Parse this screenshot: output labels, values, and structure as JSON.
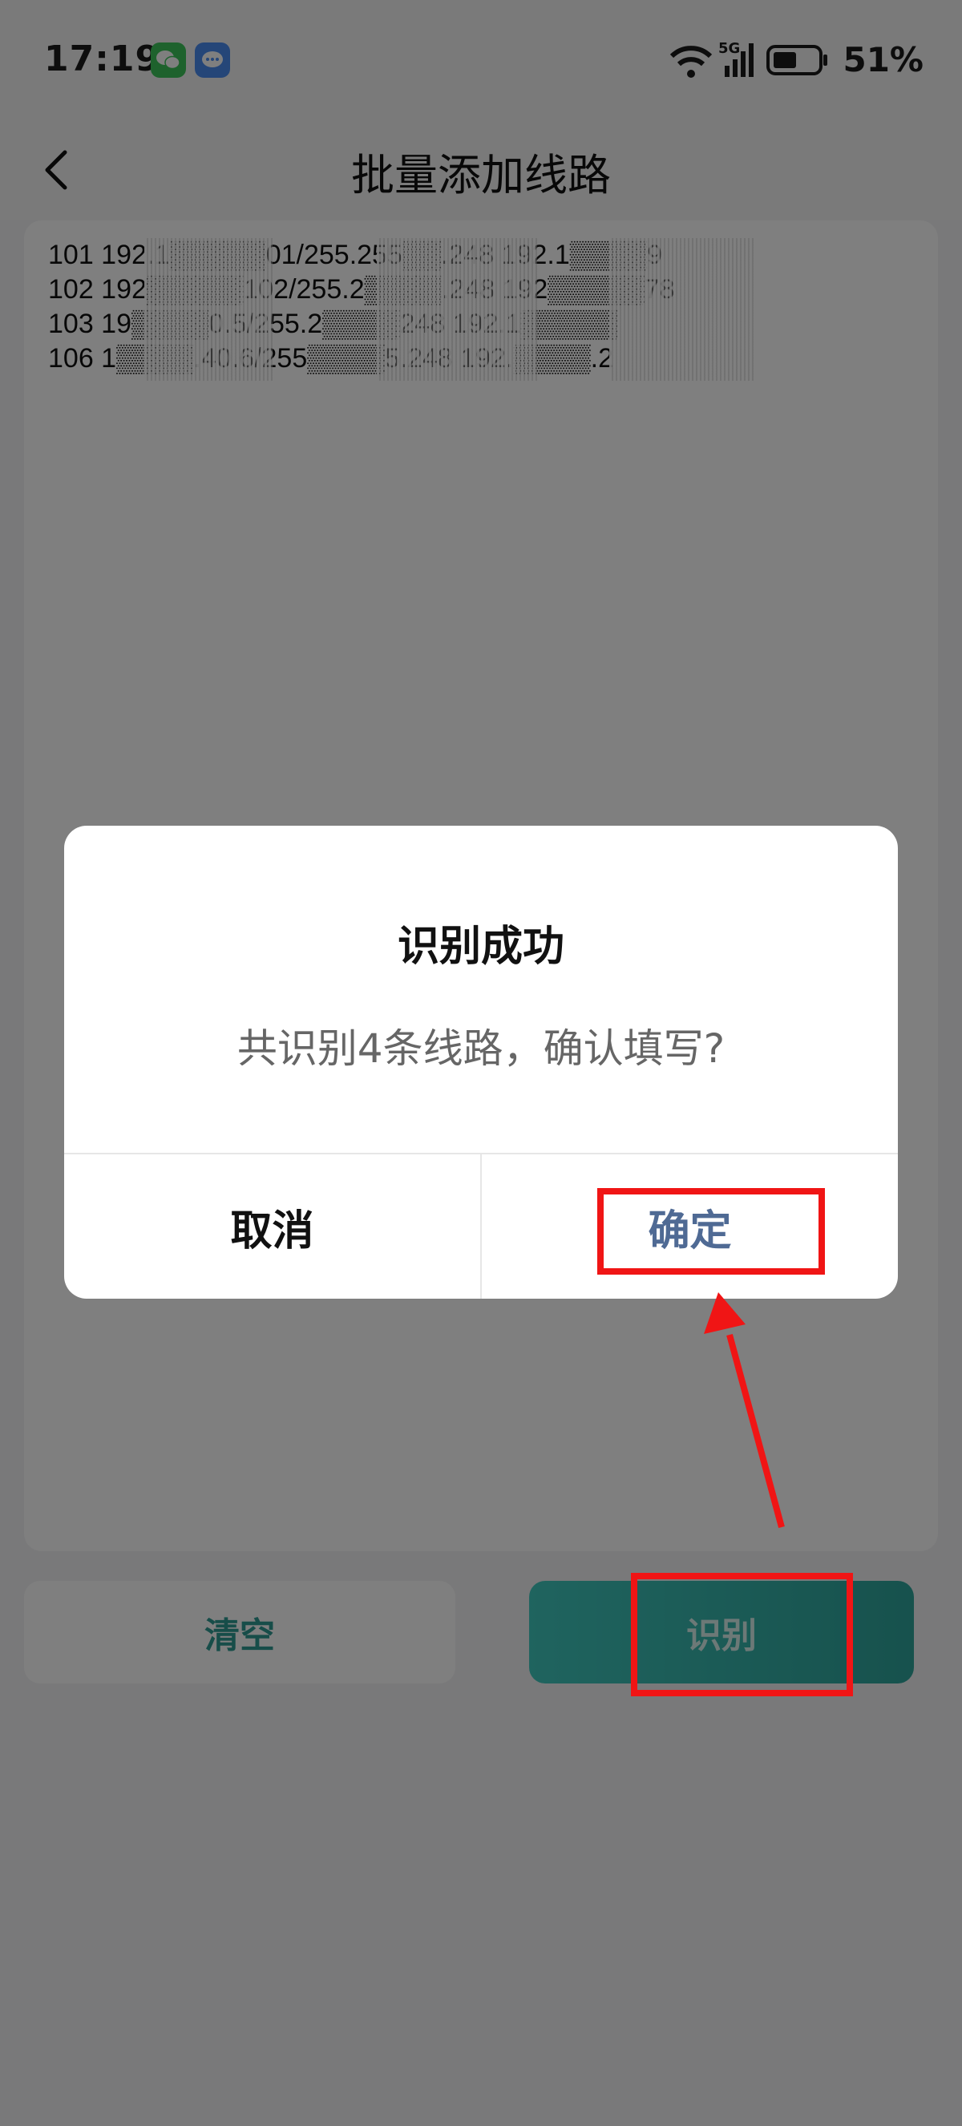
{
  "status_bar": {
    "time": "17:19",
    "network": "5G",
    "battery": "51%"
  },
  "header": {
    "title": "批量添加线路"
  },
  "routes_text": [
    "101 192.1▒▒▒▒▒01/255.255▒▒.248 192.1▒▒▒▒9",
    "102 192▒▒▒▒▒102/255.2▒▒▒▒.248 192▒▒▒▒▒78",
    "103 19▒▒▒▒0.5/255.2▒▒▒▒248 192.1▒▒▒▒▒",
    "106 1▒▒▒▒.40.6/255▒▒▒▒5.248 192.▒▒▒▒.2"
  ],
  "buttons": {
    "clear": "清空",
    "recognize": "识别"
  },
  "dialog": {
    "title": "识别成功",
    "message": "共识别4条线路，确认填写?",
    "cancel": "取消",
    "confirm": "确定"
  },
  "colors": {
    "accent": "#2ea49b",
    "confirm": "#4f6a94",
    "annotation": "#f01515"
  }
}
